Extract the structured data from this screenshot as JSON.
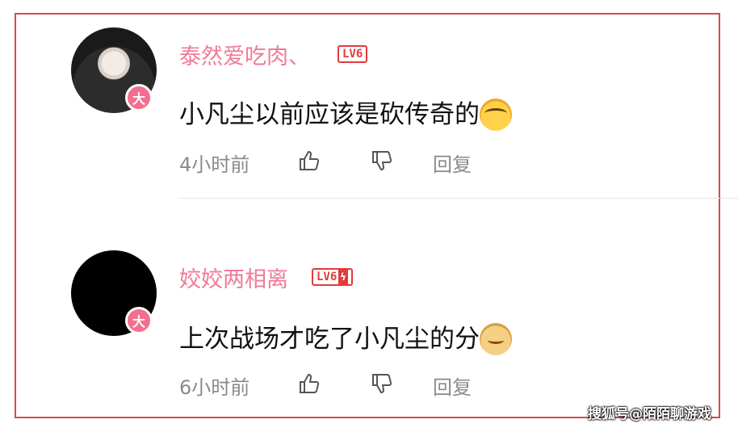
{
  "comments": [
    {
      "username": "泰然爱吃肉、",
      "level": "LV6",
      "level_bolt": "",
      "content": "小凡尘以前应该是砍传奇的",
      "emoji": "laughing-crying-emoji",
      "time": "4小时前",
      "reply_label": "回复",
      "avatar_badge": "大"
    },
    {
      "username": "姣姣两相离",
      "level": "LV6",
      "level_bolt": "ϟ",
      "content": "上次战场才吃了小凡尘的分",
      "emoji": "doge-emoji",
      "time": "6小时前",
      "reply_label": "回复",
      "avatar_badge": "大"
    }
  ],
  "watermark": "搜狐号@陌陌聊游戏",
  "colors": {
    "username": "#f07a9a",
    "level_badge": "#e23b3b",
    "border": "#d94a4a",
    "meta": "#8a8a8a"
  }
}
